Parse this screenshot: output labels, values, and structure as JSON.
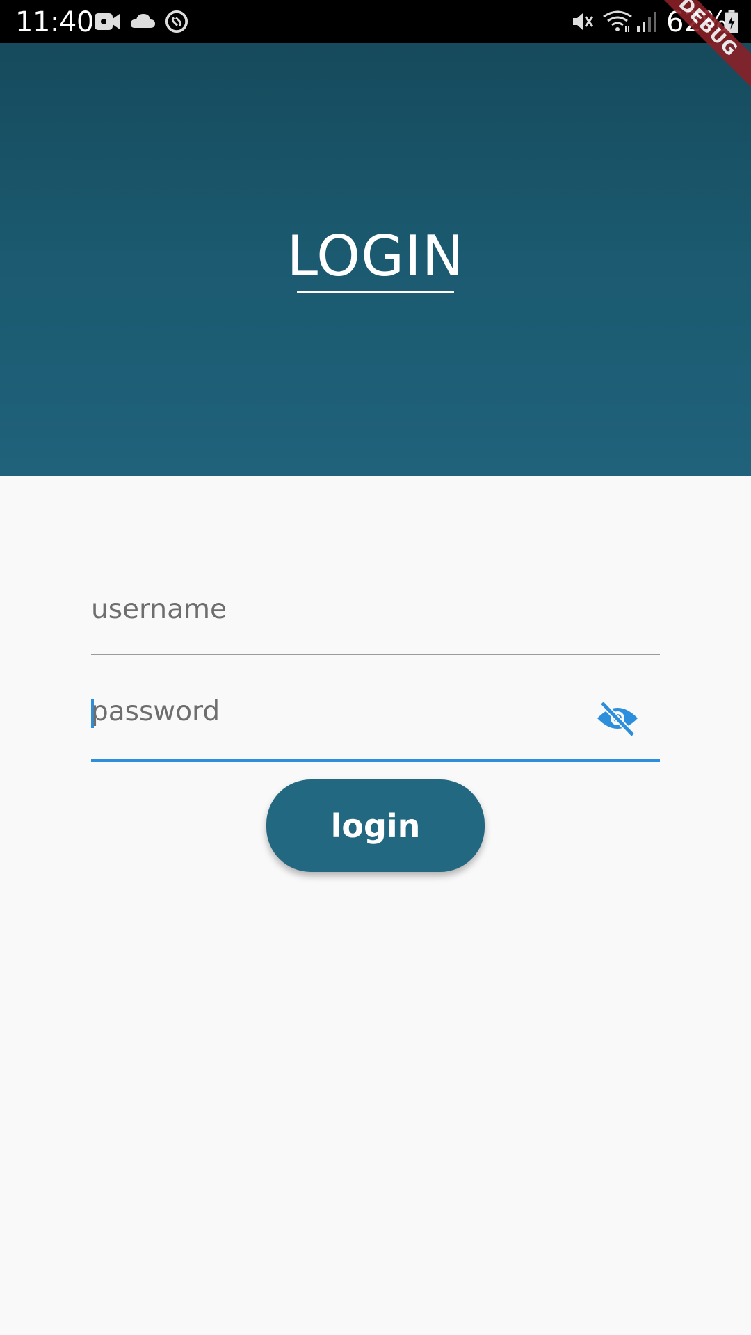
{
  "status_bar": {
    "time": "11:40",
    "battery_percent": "62%",
    "icons": [
      "video-camera-icon",
      "cloud-icon",
      "shazam-icon",
      "mute-icon",
      "wifi-icon",
      "signal-icon",
      "battery-charging-icon"
    ]
  },
  "debug_banner": "DEBUG",
  "header": {
    "title": "LOGIN",
    "gradient_top": "#164a5c",
    "gradient_bottom": "#20627b"
  },
  "form": {
    "username": {
      "placeholder": "username",
      "value": ""
    },
    "password": {
      "placeholder": "password",
      "value": "",
      "focused": true,
      "visibility_icon": "visibility-off-icon"
    },
    "accent_color": "#2d8fdc"
  },
  "login_button": {
    "label": "login",
    "color": "#236881"
  }
}
